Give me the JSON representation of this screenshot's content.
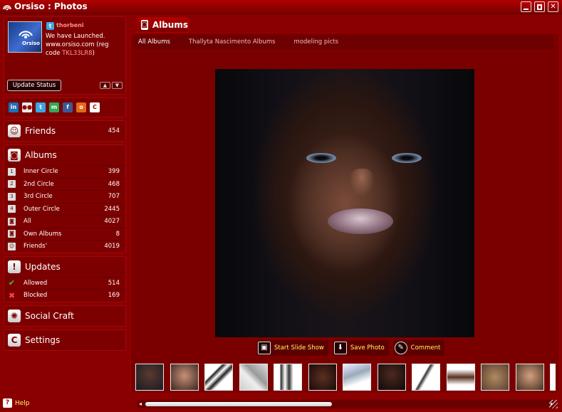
{
  "app": {
    "title": "Orsiso : Photos",
    "help_label": "Help"
  },
  "window_controls": [
    "minimize",
    "restore",
    "close"
  ],
  "status": {
    "username": "thorbeni",
    "avatar_label": "Orsiso",
    "message": "We have Launched. www.orsiso.com (reg code ",
    "reg_code": "TKL33LR8",
    "message_end": ")",
    "update_label": "Update Status"
  },
  "social_icons": [
    {
      "name": "linkedin-icon",
      "glyph": "in",
      "color": "#1e6fb5"
    },
    {
      "name": "flickr-icon",
      "glyph": "●●",
      "color": "#e8e8e8"
    },
    {
      "name": "twitter-icon",
      "glyph": "t",
      "color": "#3ba7e2"
    },
    {
      "name": "myspace-icon",
      "glyph": "m",
      "color": "#34a853"
    },
    {
      "name": "facebook-icon",
      "glyph": "f",
      "color": "#3b5998"
    },
    {
      "name": "orkut-icon",
      "glyph": "o",
      "color": "#e46a1a"
    },
    {
      "name": "orsiso-icon",
      "glyph": "C",
      "color": "#ffffff"
    }
  ],
  "friends": {
    "label": "Friends",
    "count": "454"
  },
  "albums": {
    "label": "Albums",
    "items": [
      {
        "label": "Inner Circle",
        "count": "399"
      },
      {
        "label": "2nd Circle",
        "count": "468"
      },
      {
        "label": "3rd Circle",
        "count": "707"
      },
      {
        "label": "Outer Circle",
        "count": "2445"
      },
      {
        "label": "All",
        "count": "4027"
      },
      {
        "label": "Own Albums",
        "count": "8"
      },
      {
        "label": "Friends'",
        "count": "4019"
      }
    ]
  },
  "updates": {
    "label": "Updates",
    "items": [
      {
        "label": "Allowed",
        "count": "514"
      },
      {
        "label": "Blocked",
        "count": "169"
      }
    ]
  },
  "social_craft": {
    "label": "Social Craft"
  },
  "settings": {
    "label": "Settings"
  },
  "main": {
    "tab_label": "Albums",
    "subtabs": [
      "All Albums",
      "Thallyta Nascimento Albums",
      "modeling picts"
    ],
    "actions": {
      "slideshow": "Start Slide Show",
      "save": "Save Photo",
      "comment": "Comment"
    }
  },
  "thumbnails_count": 13
}
